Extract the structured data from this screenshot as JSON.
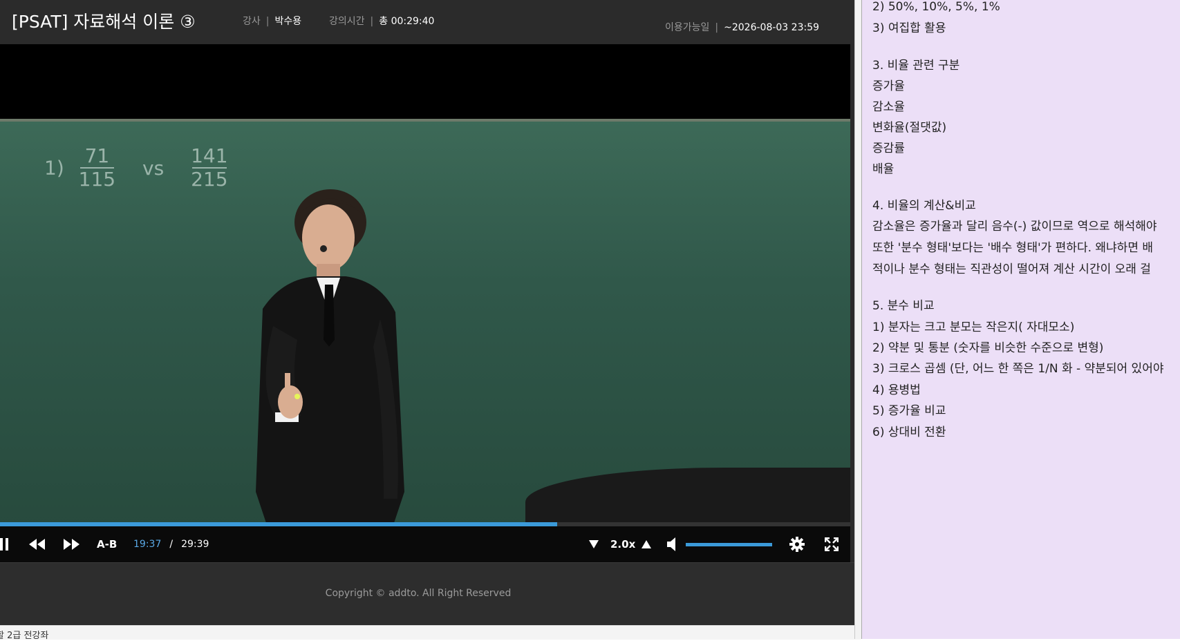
{
  "header": {
    "title": "[PSAT] 자료해석 이론 ③",
    "instructor_label": "강사",
    "instructor": "박수용",
    "duration_label": "강의시간",
    "duration": "총 00:29:40",
    "available_label": "이용가능일",
    "available_until": "~2026-08-03 23:59"
  },
  "video": {
    "board_prefix": "1)",
    "frac1_num": "71",
    "frac1_den": "115",
    "vs": "vs",
    "frac2_num": "141",
    "frac2_den": "215"
  },
  "player": {
    "progress": 0.655,
    "ab_label": "A-B",
    "current_time": "19:37",
    "time_separator": "/",
    "total_time": "29:39",
    "speed": "2.0x",
    "volume": 1.0
  },
  "footer": {
    "copyright": "Copyright © addto. All Right Reserved"
  },
  "bottom_strip": {
    "text": "할 2급 전강좌"
  },
  "notes": {
    "lines": [
      "2) 50%, 10%, 5%, 1%",
      "3) 여집합 활용",
      "3. 비율 관련 구분",
      "증가율",
      "감소율",
      "변화율(절댓값)",
      "증감률",
      "배율",
      "4. 비율의 계산&비교",
      "감소율은 증가율과 달리 음수(-) 값이므로 역으로 해석해야",
      "또한 '분수 형태'보다는 '배수 형태'가 편하다. 왜냐하면 배",
      "적이나 분수 형태는 직관성이 떨어져 계산 시간이 오래 걸",
      "5. 분수 비교",
      "1) 분자는 크고 분모는 작은지( 자대모소)",
      "2) 약분 및 통분 (숫자를 비슷한 수준으로 변형)",
      "3) 크로스 곱셈 (단, 어느 한 쪽은 1/N 화 - 약분되어 있어야",
      "4) 용병법",
      "5) 증가율 비교",
      "6) 상대비 전환"
    ]
  },
  "colors": {
    "accent": "#3b9ad9",
    "notes_bg": "#ecdff7",
    "player_bg": "#2a2a2a"
  }
}
